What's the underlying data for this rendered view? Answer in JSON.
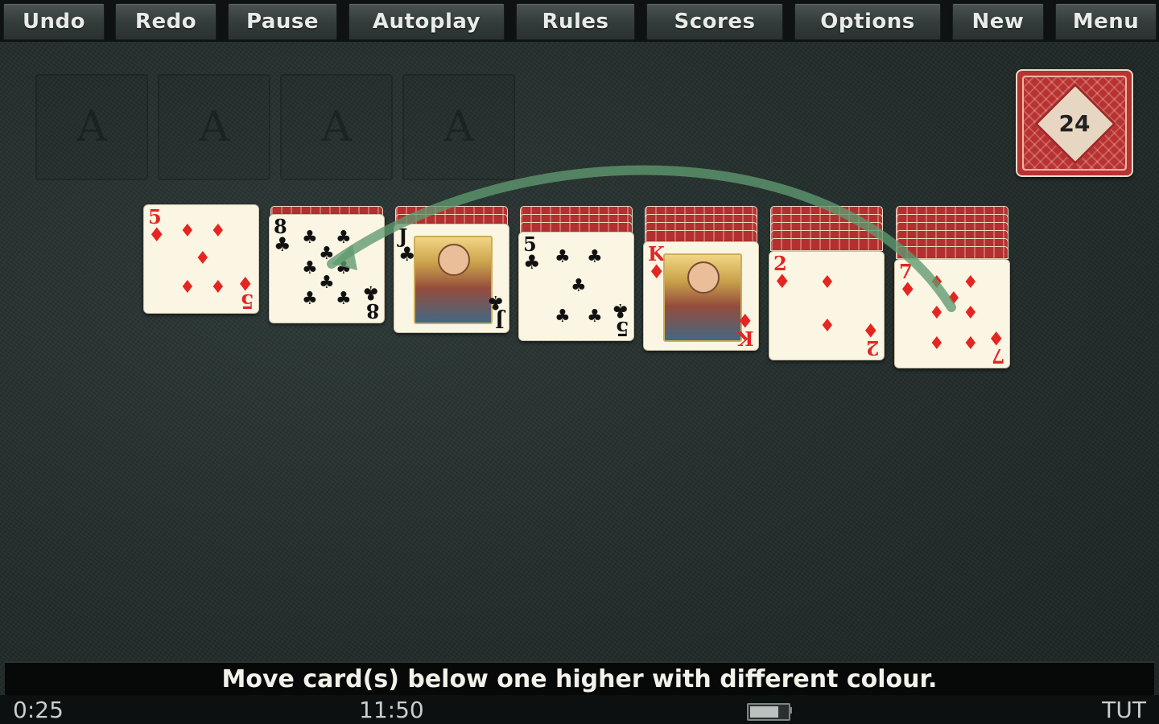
{
  "toolbar": {
    "buttons": [
      {
        "label": "Undo"
      },
      {
        "label": "Redo"
      },
      {
        "label": "Pause"
      },
      {
        "label": "Autoplay"
      },
      {
        "label": "Rules"
      },
      {
        "label": "Scores"
      },
      {
        "label": "Options"
      },
      {
        "label": "New"
      },
      {
        "label": "Menu"
      }
    ]
  },
  "foundations": [
    {
      "label": "A"
    },
    {
      "label": "A"
    },
    {
      "label": "A"
    },
    {
      "label": "A"
    }
  ],
  "stock": {
    "count": "24"
  },
  "tableau": [
    {
      "hidden": 0,
      "rank": "5",
      "suit": "♦",
      "color": "red"
    },
    {
      "hidden": 1,
      "rank": "8",
      "suit": "♣",
      "color": "black"
    },
    {
      "hidden": 2,
      "rank": "J",
      "suit": "♣",
      "color": "black"
    },
    {
      "hidden": 3,
      "rank": "5",
      "suit": "♣",
      "color": "black"
    },
    {
      "hidden": 4,
      "rank": "K",
      "suit": "♦",
      "color": "red"
    },
    {
      "hidden": 5,
      "rank": "2",
      "suit": "♦",
      "color": "red"
    },
    {
      "hidden": 6,
      "rank": "7",
      "suit": "♦",
      "color": "red"
    }
  ],
  "hint": {
    "message": "Move card(s) below one higher with different colour."
  },
  "status": {
    "elapsed": "0:25",
    "clock": "11:50",
    "battery_level": 0.75,
    "label": "TUT"
  },
  "colors": {
    "felt": "#232d2b",
    "card_back": "#b43030",
    "red_suit": "#e52521",
    "hint_arrow": "#5f9a70"
  }
}
